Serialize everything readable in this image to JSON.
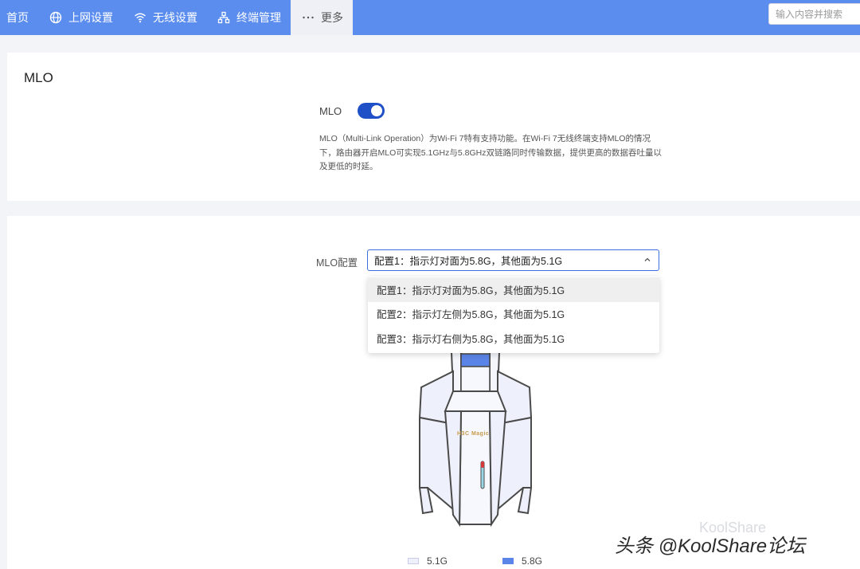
{
  "nav": {
    "home": "首页",
    "internet": "上网设置",
    "wireless": "无线设置",
    "devices": "终端管理",
    "more": "更多"
  },
  "search": {
    "placeholder": "输入内容并搜索"
  },
  "mlo_section": {
    "title": "MLO",
    "toggle_label": "MLO",
    "toggle_on": true,
    "description": "MLO（Multi-Link Operation）为Wi-Fi 7特有支持功能。在Wi-Fi 7无线终端支持MLO的情况下，路由器开启MLO可实现5.1GHz与5.8GHz双链路同时传输数据，提供更高的数据吞吐量以及更低的时延。"
  },
  "config_section": {
    "label": "MLO配置",
    "selected": "配置1：指示灯对面为5.8G，其他面为5.1G",
    "options": [
      "配置1：指示灯对面为5.8G，其他面为5.1G",
      "配置2：指示灯左侧为5.8G，其他面为5.1G",
      "配置3：指示灯右侧为5.8G，其他面为5.1G"
    ],
    "router_logo": "H3C Magic",
    "legend": [
      {
        "label": "5.1G",
        "color": "#eef0fb"
      },
      {
        "label": "5.8G",
        "color": "#5b84e8"
      }
    ]
  },
  "colors": {
    "nav_bg": "#5b8def",
    "accent": "#2050c8",
    "band_58": "#5b84e8",
    "band_51": "#eef0fb"
  },
  "watermark": {
    "text": "头条 @KoolShare论坛",
    "ghost": "KoolShare"
  }
}
